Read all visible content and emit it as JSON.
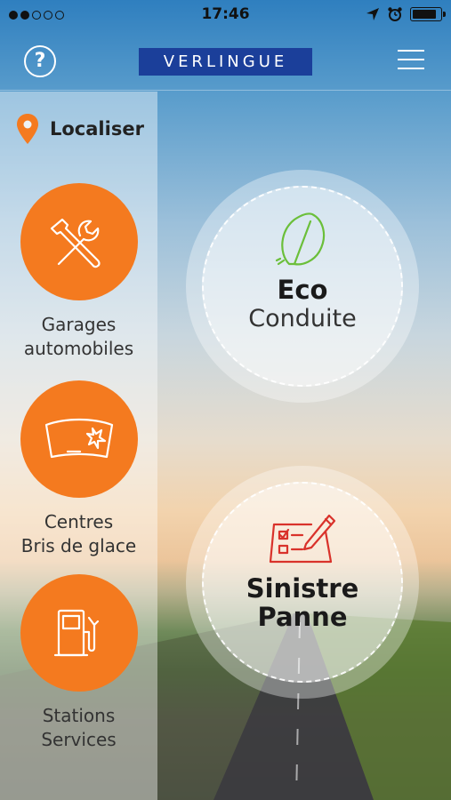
{
  "status_bar": {
    "time": "17:46",
    "signal_dots_filled": 2,
    "signal_dots_total": 5,
    "battery_level": 0.85,
    "icons": [
      "location-arrow-icon",
      "alarm-icon",
      "battery-icon"
    ]
  },
  "header": {
    "help_label": "?",
    "logo_text": "VERLINGUE",
    "logo_color": "#1b3f9a"
  },
  "sidebar": {
    "title": "Localiser",
    "accent_color": "#f47a1f",
    "items": [
      {
        "line1": "Garages",
        "line2": "automobiles",
        "icon": "tools-icon"
      },
      {
        "line1": "Centres",
        "line2": "Bris de glace",
        "icon": "windshield-icon"
      },
      {
        "line1": "Stations",
        "line2": "Services",
        "icon": "fuel-pump-icon"
      }
    ]
  },
  "main": {
    "eco": {
      "title": "Eco",
      "subtitle": "Conduite",
      "icon": "leaf-icon",
      "icon_color": "#6bbf3a"
    },
    "sinistre": {
      "line1": "Sinistre",
      "line2": "Panne",
      "icon": "checklist-pen-icon",
      "icon_color": "#d9322b"
    }
  }
}
